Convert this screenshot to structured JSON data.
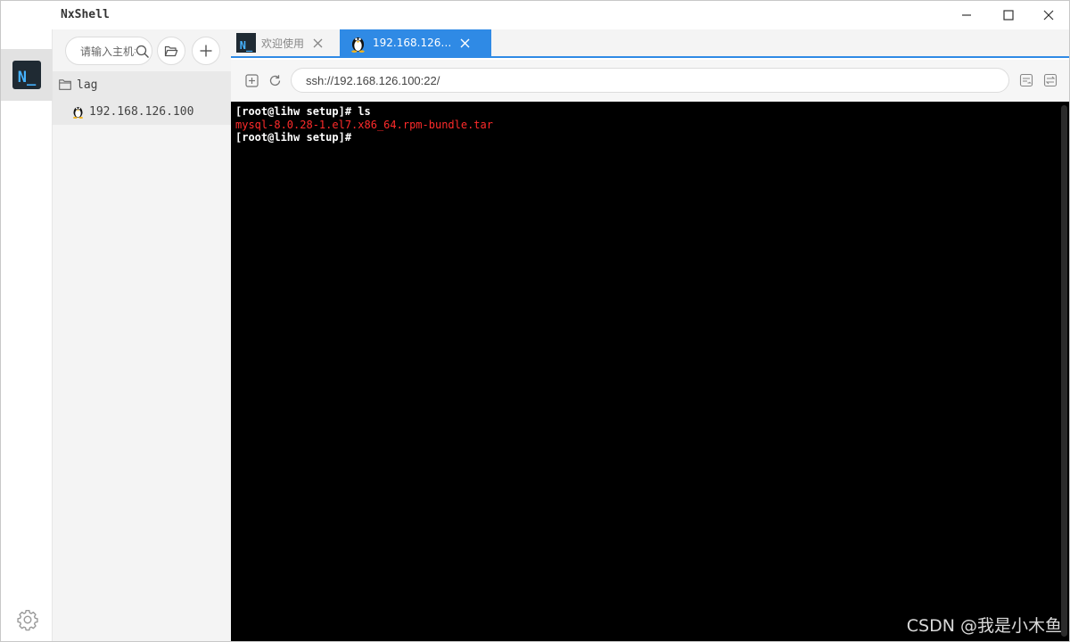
{
  "app": {
    "title": "NxShell"
  },
  "rail": {
    "logo_text": "N_"
  },
  "sidebar": {
    "search": {
      "placeholder": "请输入主机名"
    },
    "tree": [
      {
        "label": "lag",
        "icon": "folder-icon"
      },
      {
        "label": "192.168.126.100",
        "icon": "linux-penguin-icon"
      }
    ]
  },
  "tabs": [
    {
      "label": "欢迎使用",
      "icon": "nx-logo-icon"
    },
    {
      "label": "192.168.126…",
      "icon": "linux-penguin-icon",
      "active": true
    }
  ],
  "toolbar": {
    "address": "ssh://192.168.126.100:22/"
  },
  "terminal": {
    "lines": [
      {
        "text": "[root@lihw setup]# ls",
        "style": "prompt"
      },
      {
        "text": "mysql-8.0.28-1.el7.x86_64.rpm-bundle.tar",
        "style": "file"
      },
      {
        "text": "[root@lihw setup]#",
        "style": "prompt"
      }
    ]
  },
  "watermark": "CSDN @我是小木鱼",
  "colors": {
    "accent": "#2f8ae5",
    "terminal_bg": "#000000",
    "file_red": "#ff2b2b",
    "logo_blue": "#46b3ff"
  }
}
